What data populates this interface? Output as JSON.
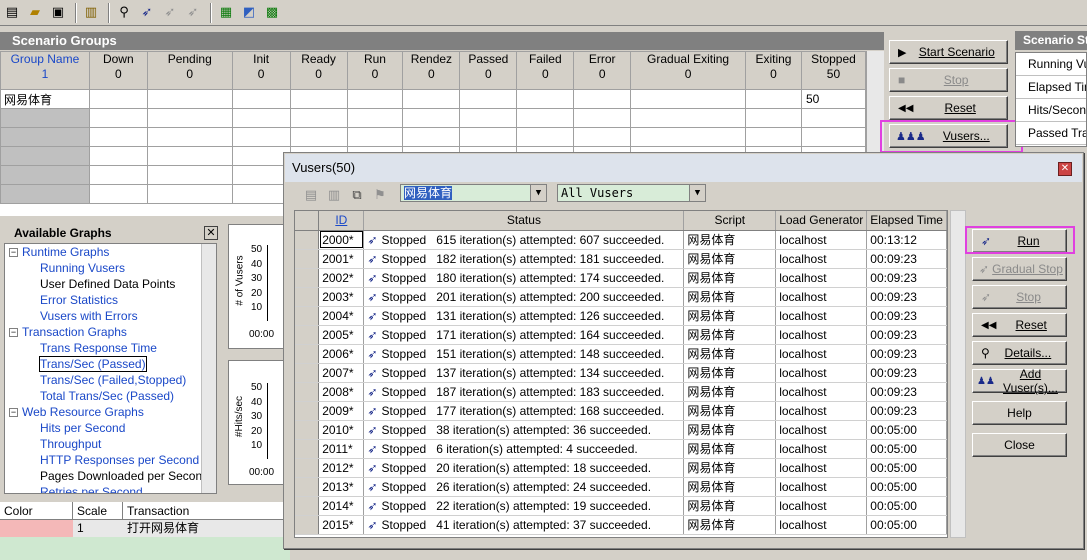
{
  "toolbar": {
    "icons": [
      "new-icon",
      "open-icon",
      "save-icon",
      "graph-icon",
      "run-icon",
      "run-dark-icon",
      "vuser-gray-icon",
      "vuser-gray2-icon",
      "analysis-icon",
      "map-icon",
      "grid-icon"
    ]
  },
  "scenario_groups": {
    "title": "Scenario Groups",
    "columns": [
      "Group Name",
      "Down",
      "Pending",
      "Init",
      "Ready",
      "Run",
      "Rendez",
      "Passed",
      "Failed",
      "Error",
      "Gradual Exiting",
      "Exiting",
      "Stopped"
    ],
    "totals": [
      "1",
      "0",
      "0",
      "0",
      "0",
      "0",
      "0",
      "0",
      "0",
      "0",
      "0",
      "0",
      "50"
    ],
    "rows": [
      {
        "name": "网易体育",
        "stopped": "50"
      }
    ]
  },
  "scenario_buttons": {
    "start": "Start Scenario",
    "stop": "Stop",
    "reset": "Reset",
    "vusers": "Vusers..."
  },
  "scenario_status": {
    "title": "Scenario Status",
    "rows": [
      "Running Vusers",
      "Elapsed Time",
      "Hits/Second",
      "Passed Transactions"
    ]
  },
  "available_graphs": {
    "title": "Available Graphs",
    "tree": [
      {
        "type": "cat",
        "label": "Runtime Graphs"
      },
      {
        "type": "item",
        "label": "Running Vusers"
      },
      {
        "type": "plain",
        "label": "User Defined Data Points"
      },
      {
        "type": "item",
        "label": "Error Statistics"
      },
      {
        "type": "item",
        "label": "Vusers with Errors"
      },
      {
        "type": "cat",
        "label": "Transaction Graphs"
      },
      {
        "type": "item",
        "label": "Trans Response Time"
      },
      {
        "type": "sel",
        "label": "Trans/Sec (Passed)"
      },
      {
        "type": "item",
        "label": "Trans/Sec (Failed,Stopped)"
      },
      {
        "type": "item",
        "label": "Total Trans/Sec (Passed)"
      },
      {
        "type": "cat",
        "label": "Web Resource Graphs"
      },
      {
        "type": "item",
        "label": "Hits per Second"
      },
      {
        "type": "item",
        "label": "Throughput"
      },
      {
        "type": "item",
        "label": "HTTP Responses per Second"
      },
      {
        "type": "plain",
        "label": "Pages Downloaded per Second"
      },
      {
        "type": "item",
        "label": "Retries per Second"
      }
    ]
  },
  "graphs": {
    "g1": {
      "ylabel": "# of Vusers",
      "ticks": [
        "50",
        "40",
        "30",
        "20",
        "10"
      ],
      "xtick": "00:00"
    },
    "g2": {
      "ylabel": "#Hits/sec",
      "ticks": [
        "50",
        "40",
        "30",
        "20",
        "10"
      ],
      "xtick": "00:00"
    }
  },
  "legend": {
    "columns": [
      "Color",
      "Scale",
      "Transaction"
    ],
    "row": {
      "scale": "1",
      "transaction": "打开网易体育"
    },
    "color": "#f4b8b8"
  },
  "vusers_window": {
    "title": "Vusers(50)",
    "group_combo": "网易体育",
    "filter_combo": "All Vusers",
    "columns": [
      "ID",
      "Status",
      "Script",
      "Load Generator",
      "Elapsed Time"
    ],
    "rows": [
      {
        "id": "2000*",
        "state": "Stopped",
        "detail": "615 iteration(s)  attempted: 607 succeeded.",
        "script": "网易体育",
        "lg": "localhost",
        "time": "00:13:12"
      },
      {
        "id": "2001*",
        "state": "Stopped",
        "detail": "182 iteration(s)  attempted: 181 succeeded.",
        "script": "网易体育",
        "lg": "localhost",
        "time": "00:09:23"
      },
      {
        "id": "2002*",
        "state": "Stopped",
        "detail": "180 iteration(s)  attempted: 174 succeeded.",
        "script": "网易体育",
        "lg": "localhost",
        "time": "00:09:23"
      },
      {
        "id": "2003*",
        "state": "Stopped",
        "detail": "201 iteration(s)  attempted: 200 succeeded.",
        "script": "网易体育",
        "lg": "localhost",
        "time": "00:09:23"
      },
      {
        "id": "2004*",
        "state": "Stopped",
        "detail": "131 iteration(s)  attempted: 126 succeeded.",
        "script": "网易体育",
        "lg": "localhost",
        "time": "00:09:23"
      },
      {
        "id": "2005*",
        "state": "Stopped",
        "detail": "171 iteration(s)  attempted: 164 succeeded.",
        "script": "网易体育",
        "lg": "localhost",
        "time": "00:09:23"
      },
      {
        "id": "2006*",
        "state": "Stopped",
        "detail": "151 iteration(s)  attempted: 148 succeeded.",
        "script": "网易体育",
        "lg": "localhost",
        "time": "00:09:23"
      },
      {
        "id": "2007*",
        "state": "Stopped",
        "detail": "137 iteration(s)  attempted: 134 succeeded.",
        "script": "网易体育",
        "lg": "localhost",
        "time": "00:09:23"
      },
      {
        "id": "2008*",
        "state": "Stopped",
        "detail": "187 iteration(s)  attempted: 183 succeeded.",
        "script": "网易体育",
        "lg": "localhost",
        "time": "00:09:23"
      },
      {
        "id": "2009*",
        "state": "Stopped",
        "detail": "177 iteration(s)  attempted: 168 succeeded.",
        "script": "网易体育",
        "lg": "localhost",
        "time": "00:09:23"
      },
      {
        "id": "2010*",
        "state": "Stopped",
        "detail": "38 iteration(s)  attempted: 36 succeeded.",
        "script": "网易体育",
        "lg": "localhost",
        "time": "00:05:00"
      },
      {
        "id": "2011*",
        "state": "Stopped",
        "detail": "6 iteration(s)  attempted: 4 succeeded.",
        "script": "网易体育",
        "lg": "localhost",
        "time": "00:05:00"
      },
      {
        "id": "2012*",
        "state": "Stopped",
        "detail": "20 iteration(s)  attempted: 18 succeeded.",
        "script": "网易体育",
        "lg": "localhost",
        "time": "00:05:00"
      },
      {
        "id": "2013*",
        "state": "Stopped",
        "detail": "26 iteration(s)  attempted: 24 succeeded.",
        "script": "网易体育",
        "lg": "localhost",
        "time": "00:05:00"
      },
      {
        "id": "2014*",
        "state": "Stopped",
        "detail": "22 iteration(s)  attempted: 19 succeeded.",
        "script": "网易体育",
        "lg": "localhost",
        "time": "00:05:00"
      },
      {
        "id": "2015*",
        "state": "Stopped",
        "detail": "41 iteration(s)  attempted: 37 succeeded.",
        "script": "网易体育",
        "lg": "localhost",
        "time": "00:05:00"
      }
    ],
    "buttons": {
      "run": "Run",
      "gradual_stop": "Gradual Stop",
      "stop": "Stop",
      "reset": "Reset",
      "details": "Details...",
      "add_vuser": "Add Vuser(s)...",
      "help": "Help",
      "close": "Close"
    }
  },
  "colors": {
    "highlight": "#e040e0",
    "link": "#1a48c8",
    "legend_bg": "#cfe8d0"
  }
}
